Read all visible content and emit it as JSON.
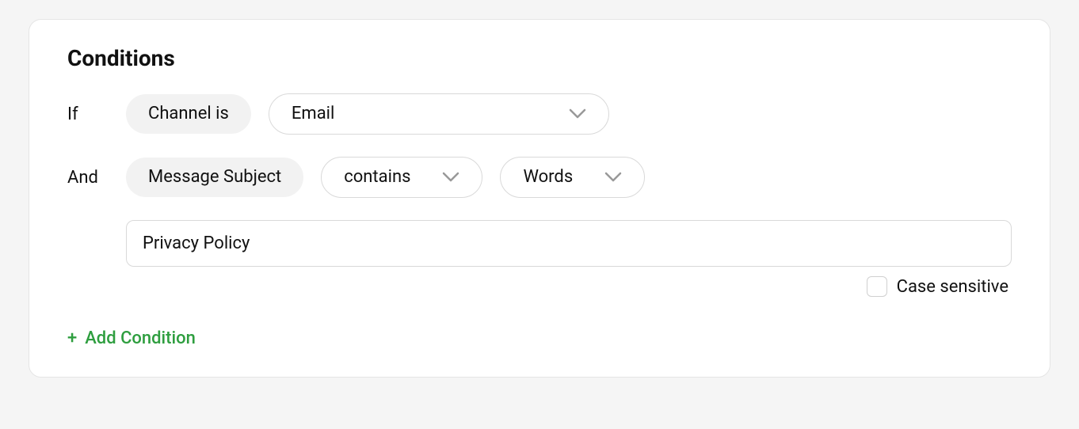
{
  "title": "Conditions",
  "rows": [
    {
      "conj": "If",
      "field": "Channel is",
      "value": "Email"
    },
    {
      "conj": "And",
      "field": "Message Subject",
      "operator": "contains",
      "matchType": "Words",
      "text": "Privacy Policy",
      "caseSensitiveLabel": "Case sensitive"
    }
  ],
  "addConditionLabel": "Add Condition"
}
